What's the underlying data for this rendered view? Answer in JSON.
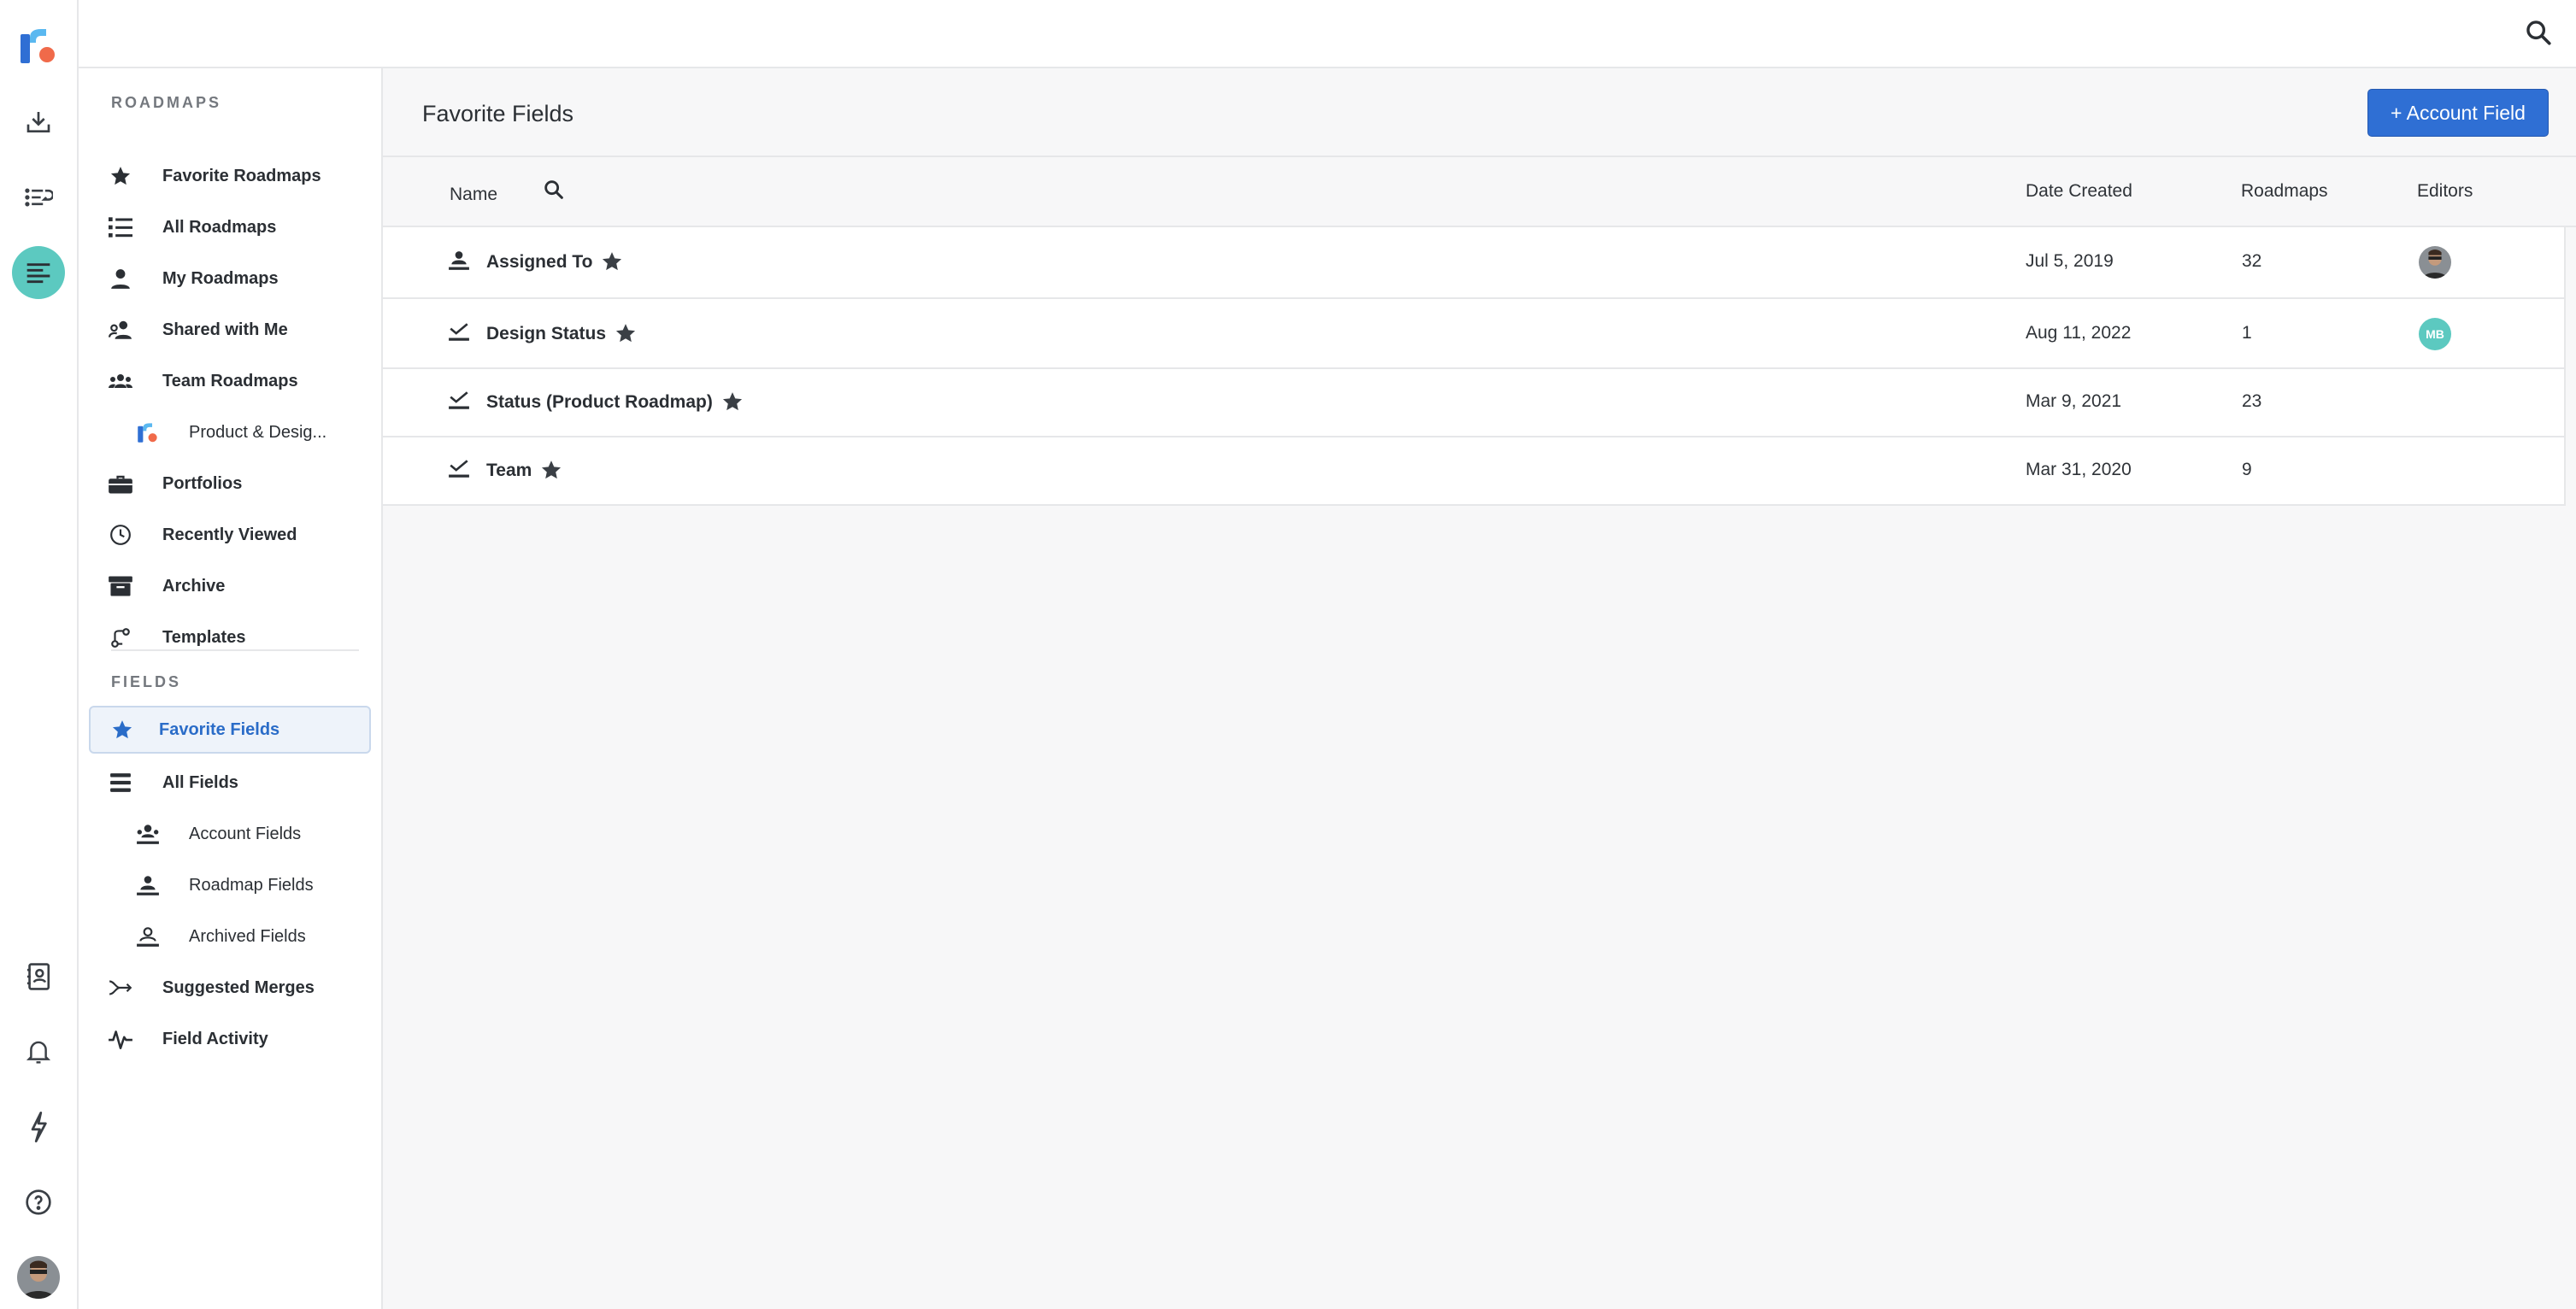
{
  "topbar": {
    "search_icon": "search-icon"
  },
  "rail": {
    "logo": "roadmunk-logo",
    "items": [
      {
        "icon": "inbox-download-icon"
      },
      {
        "icon": "list-arrow-icon"
      },
      {
        "icon": "fields-lines-icon",
        "active": true
      },
      {
        "icon": "contacts-book-icon"
      },
      {
        "icon": "bell-icon"
      },
      {
        "icon": "lightning-icon"
      },
      {
        "icon": "help-circle-icon"
      }
    ],
    "active_color": "#5cc9c0"
  },
  "sidebar": {
    "roadmaps_title": "ROADMAPS",
    "roadmaps": [
      {
        "label": "Favorite Roadmaps",
        "icon": "star-icon"
      },
      {
        "label": "All Roadmaps",
        "icon": "list-icon"
      },
      {
        "label": "My Roadmaps",
        "icon": "person-icon"
      },
      {
        "label": "Shared with Me",
        "icon": "shared-people-icon"
      },
      {
        "label": "Team Roadmaps",
        "icon": "team-icon"
      },
      {
        "label": "Product & Desig...",
        "icon": "roadmap-logo-icon"
      },
      {
        "label": "Portfolios",
        "icon": "briefcase-icon"
      },
      {
        "label": "Recently Viewed",
        "icon": "clock-icon"
      },
      {
        "label": "Archive",
        "icon": "archive-box-icon"
      },
      {
        "label": "Templates",
        "icon": "templates-icon"
      }
    ],
    "fields_title": "FIELDS",
    "fields": [
      {
        "label": "Favorite Fields",
        "icon": "star-icon",
        "selected": true
      },
      {
        "label": "All Fields",
        "icon": "stack-icon"
      },
      {
        "label": "Account Fields",
        "icon": "account-fields-icon"
      },
      {
        "label": "Roadmap Fields",
        "icon": "roadmap-fields-icon"
      },
      {
        "label": "Archived Fields",
        "icon": "archived-fields-icon"
      },
      {
        "label": "Suggested Merges",
        "icon": "merge-arrow-icon"
      },
      {
        "label": "Field Activity",
        "icon": "activity-pulse-icon"
      }
    ]
  },
  "main": {
    "title": "Favorite Fields",
    "add_button": "+ Account Field",
    "accent_color": "#2f6fd4",
    "columns": {
      "name": "Name",
      "date_created": "Date Created",
      "roadmaps": "Roadmaps",
      "editors": "Editors"
    },
    "rows": [
      {
        "name": "Assigned To",
        "type_icon": "person-field-icon",
        "date": "Jul 5, 2019",
        "roadmaps": "32",
        "editor": "avatar-photo"
      },
      {
        "name": "Design Status",
        "type_icon": "status-field-icon",
        "date": "Aug 11, 2022",
        "roadmaps": "1",
        "editor_initials": "MB"
      },
      {
        "name": "Status (Product Roadmap)",
        "type_icon": "status-field-icon",
        "date": "Mar 9, 2021",
        "roadmaps": "23"
      },
      {
        "name": "Team",
        "type_icon": "status-field-icon",
        "date": "Mar 31, 2020",
        "roadmaps": "9"
      }
    ]
  }
}
